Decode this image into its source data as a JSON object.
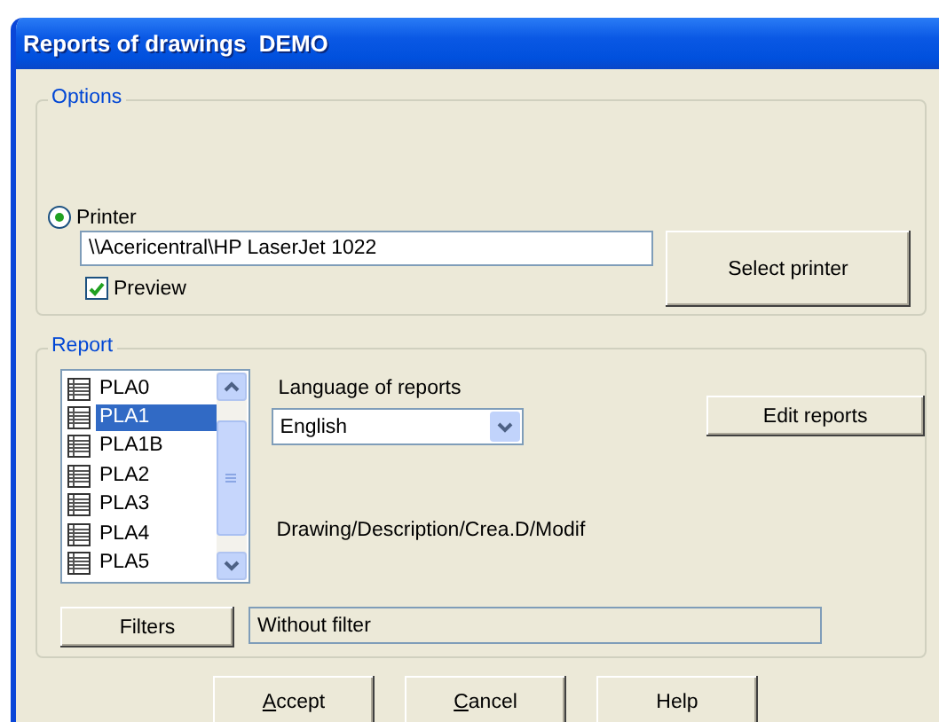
{
  "window": {
    "title": "Reports of drawings  DEMO"
  },
  "options": {
    "legend": "Options",
    "printer": {
      "label": "Printer",
      "selected": true
    },
    "printer_path": "\\\\Acericentral\\HP LaserJet 1022",
    "preview": {
      "label": "Preview",
      "checked": true
    },
    "select_printer_button": "Select printer"
  },
  "report": {
    "legend": "Report",
    "reports": [
      {
        "label": "PLA0",
        "selected": false
      },
      {
        "label": "PLA1",
        "selected": true
      },
      {
        "label": "PLA1B",
        "selected": false
      },
      {
        "label": "PLA2",
        "selected": false
      },
      {
        "label": "PLA3",
        "selected": false
      },
      {
        "label": "PLA4",
        "selected": false
      },
      {
        "label": "PLA5",
        "selected": false
      }
    ],
    "language_label": "Language of reports",
    "language": "English",
    "edit_reports_button": "Edit reports",
    "description": "Drawing/Description/Crea.D/Modif",
    "filters_button": "Filters",
    "filter_value": "Without filter"
  },
  "buttons": [
    {
      "mnemonic": "A",
      "rest": "ccept"
    },
    {
      "mnemonic": "C",
      "rest": "ancel"
    },
    {
      "rest": "Help"
    }
  ]
}
